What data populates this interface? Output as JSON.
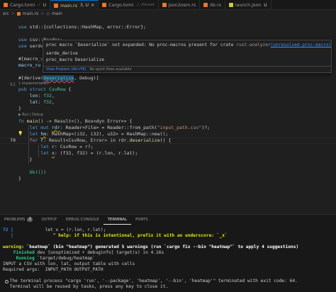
{
  "tabs": [
    {
      "label": "Cargo.toml",
      "suffix": "../",
      "status": "U",
      "icon_color": "#e37933",
      "active": false
    },
    {
      "label": "main.rs",
      "suffix": "",
      "status": "3, U",
      "icon_color": "#e37933",
      "active": true,
      "close": "×"
    },
    {
      "label": "Cargo.toml",
      "suffix": "../../tessel",
      "status": "",
      "icon_color": "#e37933",
      "active": false
    },
    {
      "label": "json2osm.rs",
      "suffix": "",
      "status": "",
      "icon_color": "#e37933",
      "active": false
    },
    {
      "label": "lib.rs",
      "suffix": "",
      "status": "",
      "icon_color": "#e37933",
      "active": false
    },
    {
      "label": "launch.json",
      "suffix": "",
      "status": "U",
      "icon_color": "#cbcb41",
      "active": false
    }
  ],
  "breadcrumb": {
    "folder": "src",
    "sep": ">",
    "file": "main.rs",
    "symbol": "main"
  },
  "gutter": {
    "lines": [
      "70",
      "72"
    ]
  },
  "code": {
    "line1_use": "use",
    "line1_rest": " std::{collections::HashMap, error::Error};",
    "line3_use": "use",
    "line3_rest": " csv::Reader;",
    "line4_use": "use",
    "line4_rest": " serde",
    "line6": "#[macro_u",
    "line7": "macro_ru",
    "line9_attr": "#[derive(",
    "line9_derive": "Deserialize",
    "line9_rest": ", Debug)]",
    "lens_impl": "1 implementation",
    "line10_pub": "pub struct",
    "line10_name": "CsvRow",
    "line10_rest": " {",
    "line11_field": "lon",
    "line11_type": "f32",
    "line12_field": "lat",
    "line12_type": "f32",
    "line13": "}",
    "lens_run": "▶ Run | Debug",
    "line15_fn": "fn",
    "line15_name": "main",
    "line15_rest": "() -> Result<(), Box<dyn Error>> {",
    "line16_let": "let mut",
    "line16_var": "rdr",
    "line16_rest": ": Reader<File> = Reader::from_path(",
    "line16_str": "\"input_path.csv\"",
    "line16_end": ")?;",
    "line17_let": "let",
    "line17_var": "hm",
    "line17_rest": ": HashMap<(i32, i32), u32> = HashMap::new();",
    "line18_for": "for",
    "line18_var": "r",
    "line18_rest": ": Result<CsvRow, Error> in rdr.",
    "line18_fn": "deserialize",
    "line18_end": "() {",
    "line19_let": "let",
    "line19_var": "r",
    "line19_rest": ": CsvRow = r?;",
    "line20_let": "let",
    "line20_var": "x",
    "line20_rest": ": (f32, f32) = (r.lon, r.lat);",
    "line21": "}",
    "line23": "Ok(())",
    "line24": "}"
  },
  "hover": {
    "message": "proc macro `Deserialize` not expanded: No proc-macros present for crate",
    "source": "rust-analyzer",
    "code": "(unresolved-proc-macro)",
    "suggestion1": "serde_derive",
    "suggestion2": "proc_macro Deserialize",
    "view_problem": "View Problem (Alt+F8)",
    "no_fixes": "No quick fixes available"
  },
  "panel": {
    "tabs": [
      {
        "label": "PROBLEMS",
        "badge": "3"
      },
      {
        "label": "OUTPUT",
        "badge": ""
      },
      {
        "label": "DEBUG CONSOLE",
        "badge": ""
      },
      {
        "label": "TERMINAL",
        "badge": ""
      },
      {
        "label": "PORTS",
        "badge": ""
      }
    ],
    "terminal": {
      "l1_num": "72",
      "l1_pipe": " |",
      "l1_code": "            let x = (r.lon, r.lat);",
      "l2_pipe": "   |",
      "l2_caret": "               ^ help: if this is intentional, prefix it with an underscore: `_x`",
      "l3_warn": "warning",
      "l3_rest": ": `heatmap` (bin \"heatmap\") generated 5 warnings (run `cargo fix --bin \"heatmap\"` to apply 4 suggestions)",
      "l4_key": "    Finished",
      "l4_rest": " dev [unoptimized + debuginfo] target(s) in 4.16s",
      "l5_key": "     Running",
      "l5_rest": " `target/debug/heatmap`",
      "l6": "INPUT a CSV with lon, lat, output table with cells",
      "l7": "Required args:  INPUT_PATH OUTPUT_PATH",
      "l8": " The terminal process \"cargo 'run', '--package', 'heatmap', '--bin', 'heatmap'\" terminated with exit code: 64.",
      "l9": " Terminal will be reused by tasks, press any key to close it."
    }
  }
}
